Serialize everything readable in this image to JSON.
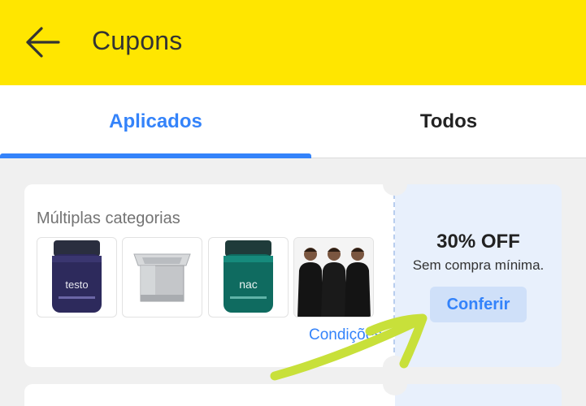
{
  "header": {
    "title": "Cupons",
    "back_icon": "arrow-left-icon",
    "background_color": "#ffe600"
  },
  "tabs": [
    {
      "label": "Aplicados",
      "active": true
    },
    {
      "label": "Todos",
      "active": false
    }
  ],
  "accent_color": "#3483fa",
  "coupon": {
    "category": "Múltiplas categorias",
    "products": [
      {
        "name": "testo-supplement-jar",
        "label": "testo"
      },
      {
        "name": "stainless-steel-box"
      },
      {
        "name": "nac-supplement-jar",
        "label": "nac"
      },
      {
        "name": "black-tshirts-men"
      }
    ],
    "conditions_label": "Condições",
    "discount": "30% OFF",
    "min_purchase": "Sem compra mínima.",
    "cta_label": "Conferir"
  }
}
